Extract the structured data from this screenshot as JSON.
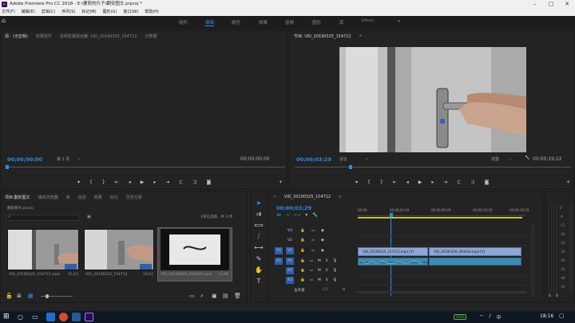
{
  "window": {
    "title": "Adobe Premiere Pro CC 2018 - E:\\要剪的片子\\翻安图文.prproj *",
    "app_icon": "Pr"
  },
  "menu": [
    "文件(F)",
    "编辑(E)",
    "剪辑(C)",
    "序列(S)",
    "标记(M)",
    "图形(G)",
    "窗口(W)",
    "帮助(H)"
  ],
  "workspaces": [
    "组件",
    "编辑",
    "颜色",
    "效果",
    "音频",
    "图形",
    "库",
    "Effects"
  ],
  "workspace_active": 1,
  "workspace_more": "»",
  "source_monitor": {
    "tabs": [
      "源：(无剪辑)",
      "效果控件",
      "音频剪辑混合器: VID_20190325_154712",
      "元数据"
    ],
    "timecode_in": "00;00;00;00",
    "page": "第 1 页",
    "timecode_out": "00;00;00;00"
  },
  "program_monitor": {
    "tab": "节目: VID_20190325_154712",
    "timecode": "00;00;03;29",
    "fit": "适合",
    "quality": "完整",
    "duration": "00;00;19;22"
  },
  "project": {
    "tabs": [
      "项目:翻安图文",
      "媒体浏览器",
      "库",
      "信息",
      "效果",
      "标记",
      "历史记录"
    ],
    "file": "翻安图文.prproj",
    "status": "1项已选择，共 3 项",
    "search_placeholder": "",
    "items": [
      {
        "name": "VID_20190325_154712.mp4",
        "duration": "15;23"
      },
      {
        "name": "VID_20190325_154712",
        "duration": "19;22"
      },
      {
        "name": "VID_20190309_094430.mp4",
        "duration": "11;06"
      }
    ]
  },
  "timeline": {
    "tab": "VID_20190325_154712",
    "timecode": "00;00;03;29",
    "ruler": [
      "00;00",
      "00;00;04;29",
      "00;00;09;29",
      "00;00;14;29",
      "00;00;19;29"
    ],
    "video_tracks": [
      "V3",
      "V2",
      "V1"
    ],
    "audio_tracks": [
      "A1",
      "A2",
      "A3"
    ],
    "source_patch": {
      "video": "V1",
      "audio": "A1"
    },
    "track_buttons": {
      "mute": "M",
      "solo": "S"
    },
    "master_label": "主声道",
    "master_value": "0.0",
    "clips": [
      {
        "label": "VID_20190325_154712.mp4 [V]"
      },
      {
        "label": "VID_20190309_094430.mp4 [V]"
      }
    ],
    "playhead_fraction": 0.2
  },
  "meter": {
    "scale": [
      "0",
      "-6",
      "-12",
      "-18",
      "-24",
      "-30",
      "-36",
      "-42",
      "-48",
      "-54"
    ]
  },
  "taskbar": {
    "time": "18:16",
    "battery": "100%"
  },
  "colors": {
    "accent": "#2d8ceb",
    "video_clip": "#8fa7d3",
    "audio_clip": "#3f8bb0",
    "panel": "#232323"
  }
}
